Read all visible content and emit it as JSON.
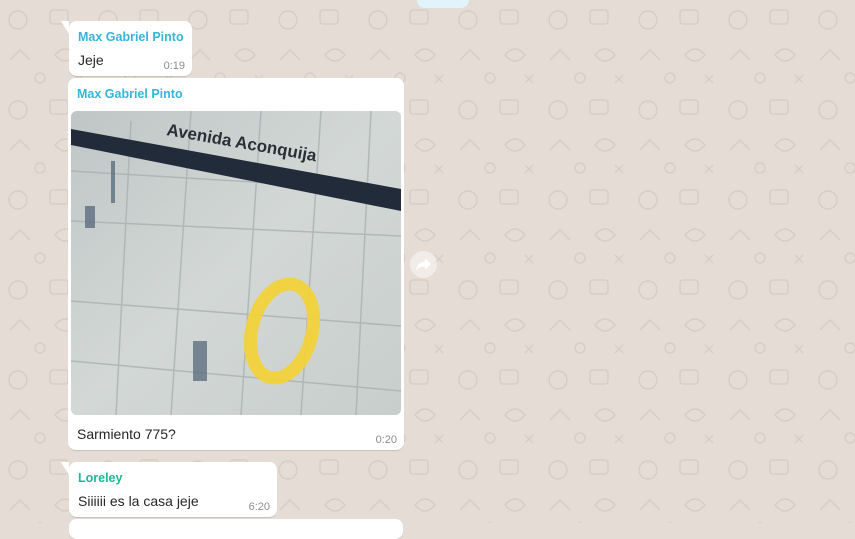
{
  "messages": [
    {
      "sender": "Max Gabriel Pinto",
      "text": "Jeje",
      "time": "0:19"
    },
    {
      "sender": "Max Gabriel Pinto",
      "image_text": "Avenida Aconquija",
      "caption": "Sarmiento 775?",
      "time": "0:20"
    },
    {
      "sender": "Loreley",
      "text": "Siiiiii es la casa jeje",
      "time": "6:20"
    }
  ],
  "colors": {
    "sender_max": "#35b5d9",
    "sender_loreley": "#1fb895",
    "chat_background": "#e5ddd5",
    "bubble": "#ffffff",
    "circle_marker": "#f1d23a"
  },
  "icons": {
    "forward": "forward-icon"
  }
}
